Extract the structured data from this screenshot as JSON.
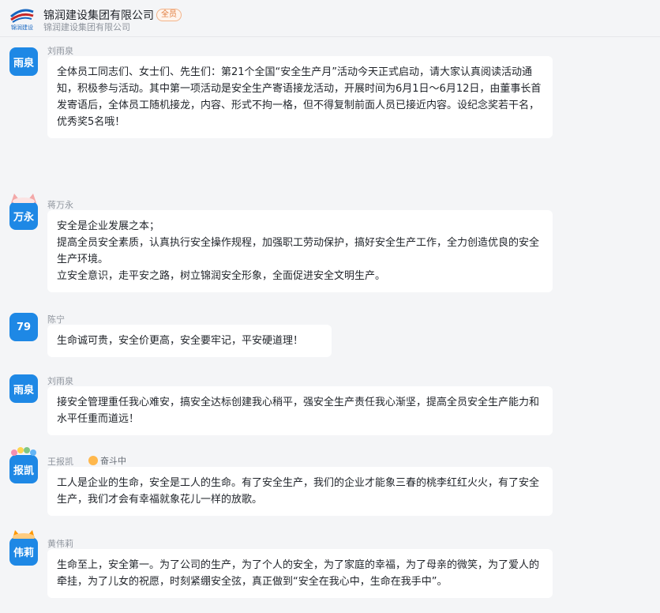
{
  "header": {
    "title": "锦润建设集团有限公司",
    "badge": "全员",
    "subtitle": "锦润建设集团有限公司",
    "logo_text": "锦润建设"
  },
  "messages": [
    {
      "sender": "刘雨泉",
      "avatar_text": "雨泉",
      "lines": [
        "全体员工同志们、女士们、先生们：第21个全国“安全生产月”活动今天正式启动，请大家认真阅读活动通知，积极参与活动。其中第一项活动是安全生产寄语接龙活动，开展时间为6月1日～6月12日，由董事长首发寄语后，全体员工随机接龙，内容、形式不拘一格，但不得复制前面人员已接近内容。设纪念奖若干名，优秀奖5名哦！"
      ]
    },
    {
      "sender": "蒋万永",
      "avatar_text": "万永",
      "lines": [
        "安全是企业发展之本；",
        "提高全员安全素质，认真执行安全操作规程，加强职工劳动保护，搞好安全生产工作，全力创造优良的安全生产环境。",
        "立安全意识，走平安之路，树立锦润安全形象，全面促进安全文明生产。"
      ]
    },
    {
      "sender": "陈宁",
      "avatar_text": "79",
      "lines": [
        "生命诚可贵，安全价更高，安全要牢记，平安硬道理！"
      ]
    },
    {
      "sender": "刘雨泉",
      "avatar_text": "雨泉",
      "lines": [
        "接安全管理重任我心难安，搞安全达标创建我心稍平，强安全生产责任我心渐坚，提高全员安全生产能力和水平任重而道远！"
      ]
    },
    {
      "sender": "王报凯",
      "avatar_text": "报凯",
      "status": "奋斗中",
      "lines": [
        "工人是企业的生命，安全是工人的生命。有了安全生产，我们的企业才能象三春的桃李红红火火，有了安全生产，我们才会有幸福就象花儿一样的放歌。"
      ]
    },
    {
      "sender": "黄伟莉",
      "avatar_text": "伟莉",
      "lines": [
        "生命至上，安全第一。为了公司的生产，为了个人的安全，为了家庭的幸福，为了母亲的微笑，为了爱人的牵挂，为了儿女的祝愿，时刻紧绷安全弦，真正做到“安全在我心中，生命在我手中”。"
      ]
    }
  ],
  "colors": {
    "avatar_blue": "#1e88e5",
    "bubble": "#ffffff",
    "background": "#f4f5f7",
    "badge": "#e07a3a"
  }
}
